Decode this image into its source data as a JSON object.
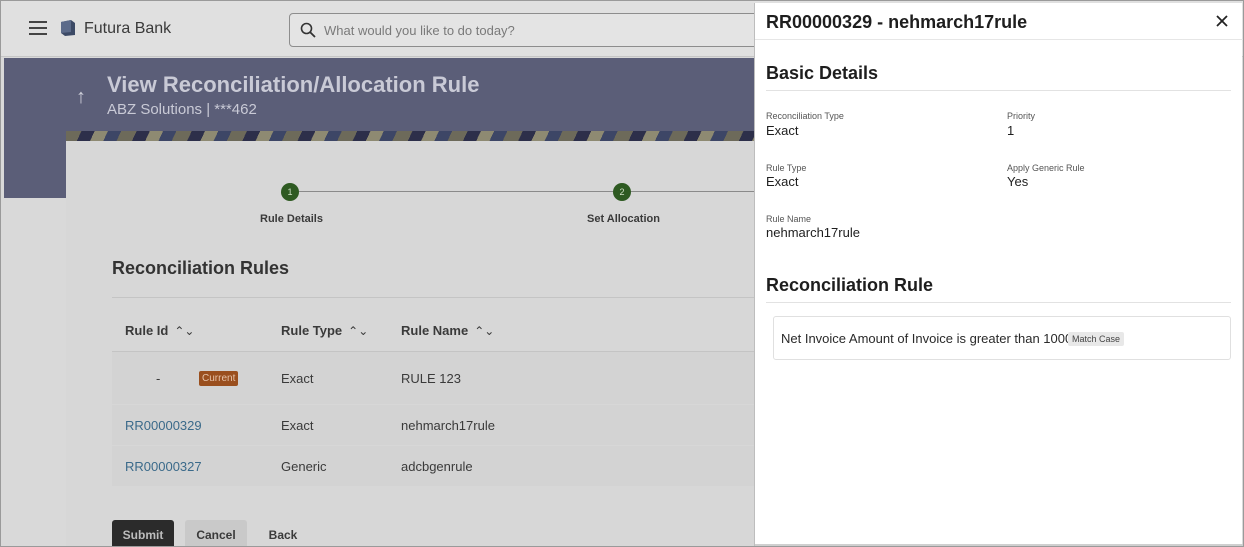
{
  "header": {
    "brand": "Futura Bank",
    "search_placeholder": "What would you like to do today?",
    "icons": [
      "hamburger-menu-icon",
      "bank-logo-icon",
      "search-icon"
    ]
  },
  "page": {
    "title": "View Reconciliation/Allocation Rule",
    "subtitle": "ABZ Solutions | ***462"
  },
  "stepper": {
    "steps": [
      {
        "number": "1",
        "label": "Rule Details"
      },
      {
        "number": "2",
        "label": "Set Allocation"
      }
    ]
  },
  "rules": {
    "title": "Reconciliation Rules",
    "columns": [
      "Rule Id",
      "Rule Type",
      "Rule Name"
    ],
    "rows": [
      {
        "rule_id": "-",
        "badge": "Current",
        "rule_type": "Exact",
        "rule_name": "RULE 123"
      },
      {
        "rule_id": "RR00000329",
        "rule_type": "Exact",
        "rule_name": "nehmarch17rule"
      },
      {
        "rule_id": "RR00000327",
        "rule_type": "Generic",
        "rule_name": "adcbgenrule"
      }
    ]
  },
  "actions": {
    "submit": "Submit",
    "cancel": "Cancel",
    "back": "Back"
  },
  "drawer": {
    "title": "RR00000329 - nehmarch17rule",
    "basic_details_title": "Basic Details",
    "fields": {
      "reconciliation_type_label": "Reconciliation Type",
      "reconciliation_type": "Exact",
      "priority_label": "Priority",
      "priority": "1",
      "rule_type_label": "Rule Type",
      "rule_type": "Exact",
      "apply_generic_label": "Apply Generic Rule",
      "apply_generic": "Yes",
      "rule_name_label": "Rule Name",
      "rule_name": "nehmarch17rule"
    },
    "rule_section_title": "Reconciliation Rule",
    "rule_text": "Net Invoice Amount of Invoice is greater than 1000",
    "rule_badge": "Match Case"
  },
  "colors": {
    "banner": "#5b5e78",
    "step_complete": "#2e5a22",
    "current_badge": "#9a4f1e",
    "link": "#3b6a8a"
  }
}
